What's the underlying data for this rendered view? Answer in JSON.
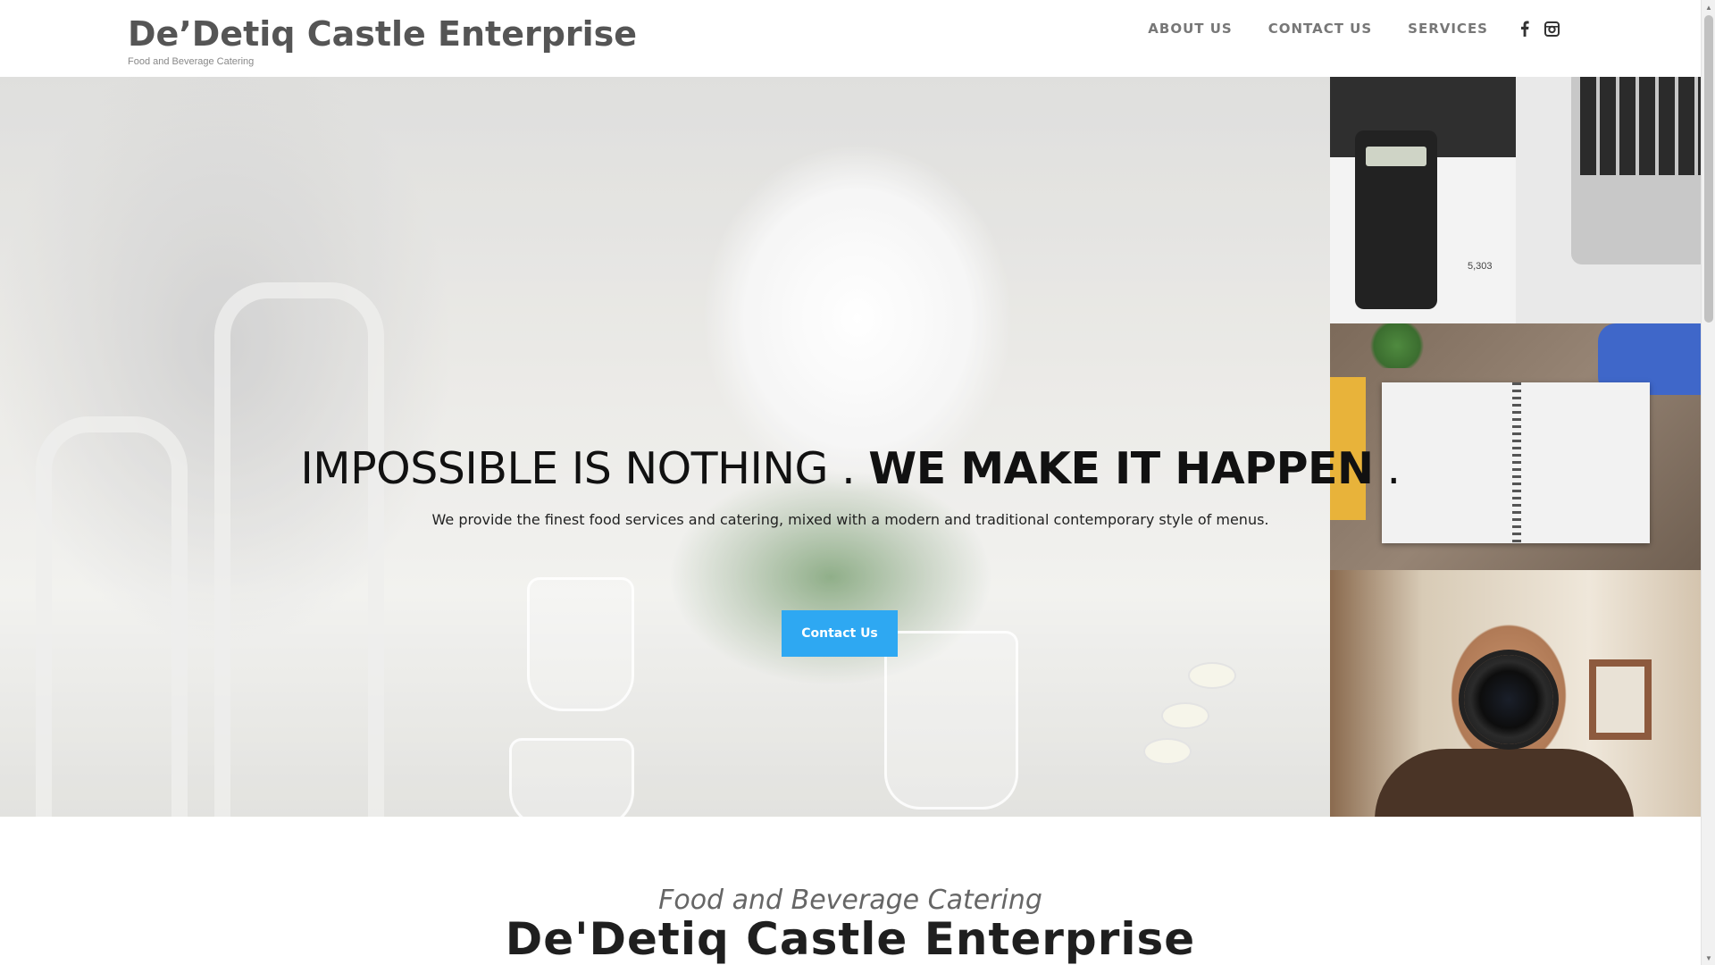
{
  "header": {
    "brand_title": "De’Detiq Castle Enterprise",
    "brand_tagline": "Food and Beverage Catering",
    "nav": {
      "about": "ABOUT US",
      "contact": "CONTACT US",
      "services": "SERVICES"
    },
    "social": [
      "facebook-icon",
      "instagram-icon"
    ]
  },
  "hero": {
    "headline_light": "IMPOSSIBLE IS NOTHING . ",
    "headline_strong": "WE MAKE IT HAPPEN",
    "headline_end": " .",
    "subline": "We provide the finest food services and catering, mixed with a modern and traditional contemporary style of menus.",
    "cta_label": "Contact Us",
    "tile_number": "5,303"
  },
  "intro": {
    "kicker": "Food and Beverage Catering",
    "title": "De'Detiq Castle Enterprise"
  },
  "colors": {
    "accent": "#2ea8f2",
    "brand_text": "#555555",
    "nav_text": "#777777"
  }
}
